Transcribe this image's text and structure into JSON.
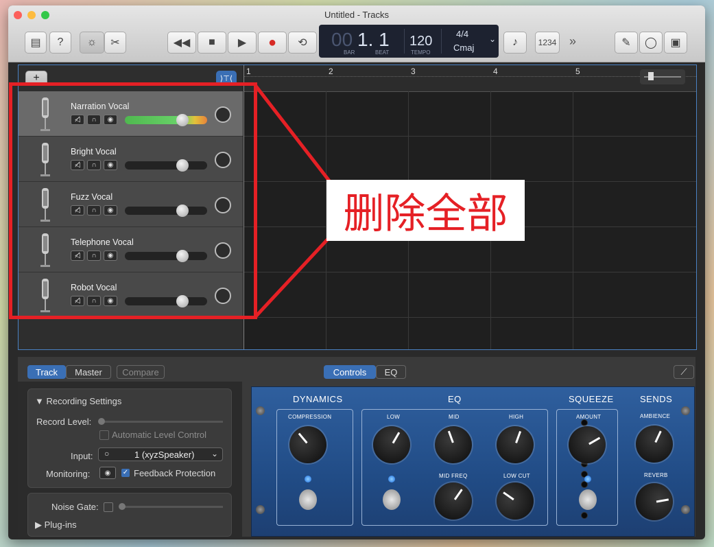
{
  "window": {
    "title": "Untitled - Tracks"
  },
  "lcd": {
    "bar_dim": "00",
    "position": "1. 1",
    "bar_label": "BAR",
    "beat_label": "BEAT",
    "tempo": "120",
    "tempo_label": "TEMPO",
    "signature": "4/4",
    "key": "Cmaj"
  },
  "toolbar": {
    "count_in": "1234",
    "more": "»"
  },
  "tracks": [
    {
      "name": "Narration Vocal",
      "selected": true
    },
    {
      "name": "Bright Vocal"
    },
    {
      "name": "Fuzz Vocal"
    },
    {
      "name": "Telephone Vocal"
    },
    {
      "name": "Robot Vocal"
    }
  ],
  "ruler": {
    "bars": [
      "1",
      "2",
      "3",
      "4",
      "5"
    ]
  },
  "annotation": {
    "callout": "删除全部",
    "box_color": "#e52025"
  },
  "bottom": {
    "tabs": {
      "track": "Track",
      "master": "Master",
      "compare": "Compare"
    },
    "view_tabs": {
      "controls": "Controls",
      "eq": "EQ"
    },
    "recording_settings": "Recording Settings",
    "record_level": "Record Level:",
    "auto_level": "Automatic Level Control",
    "input_label": "Input:",
    "input_value": "1  (xyzSpeaker)",
    "monitoring": "Monitoring:",
    "feedback": "Feedback Protection",
    "noise_gate": "Noise Gate:",
    "plugins": "Plug-ins"
  },
  "plugin": {
    "dynamics": "DYNAMICS",
    "compression": "COMPRESSION",
    "eq": "EQ",
    "low": "LOW",
    "mid": "MID",
    "high": "HIGH",
    "mid_freq": "MID FREQ",
    "low_cut": "LOW CUT",
    "squeeze": "SQUEEZE",
    "amount": "AMOUNT",
    "sends": "SENDS",
    "ambience": "AMBIENCE",
    "reverb": "REVERB"
  },
  "colors": {
    "accent": "#3a6fb5",
    "meter": "#5fd05f",
    "annotation": "#e52025"
  }
}
